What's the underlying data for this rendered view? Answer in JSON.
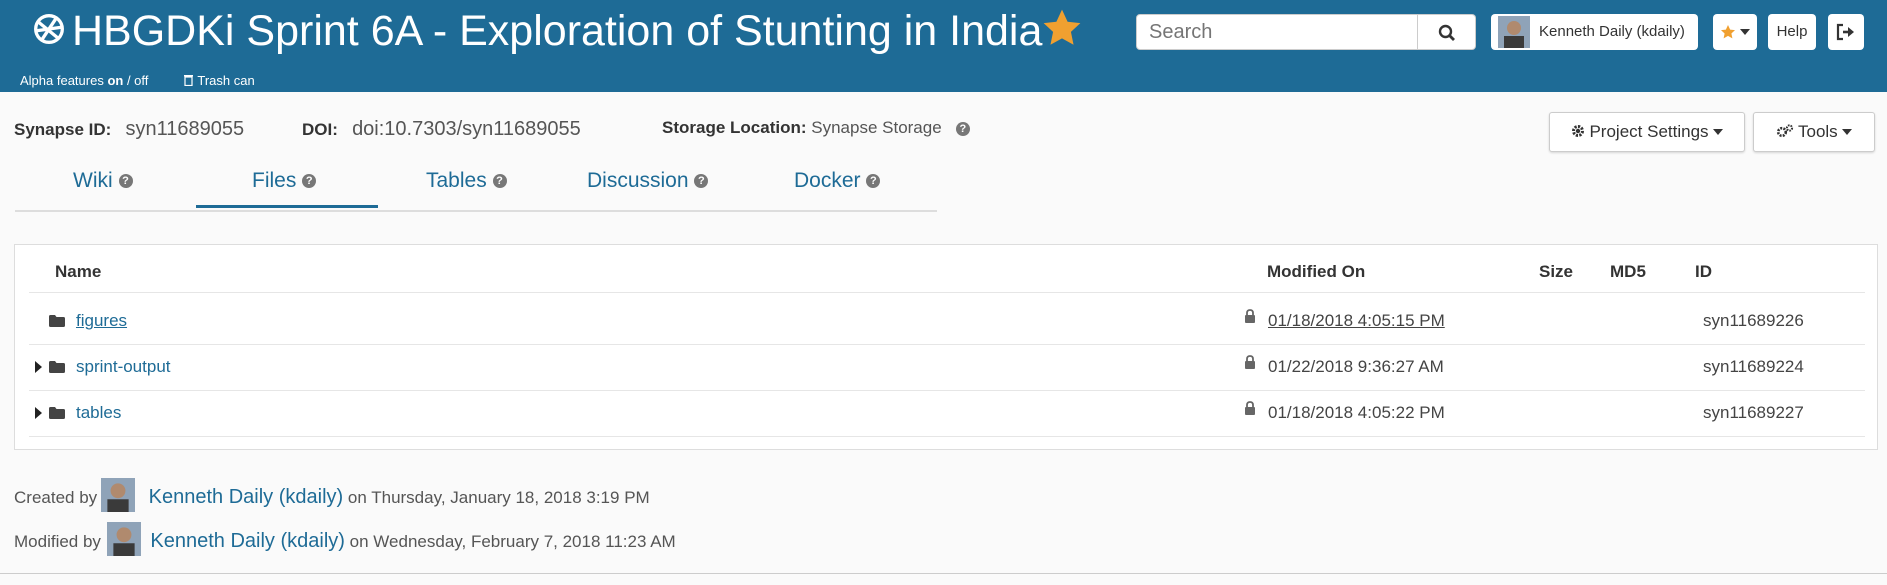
{
  "header": {
    "title": "HBGDKi Sprint 6A - Exploration of Stunting in India",
    "alpha_prefix": "Alpha features ",
    "alpha_on": "on",
    "alpha_suffix": " / off",
    "trash_label": "Trash can",
    "search_placeholder": "Search",
    "user_label": "Kenneth Daily (kdaily)",
    "help_label": "Help"
  },
  "meta": {
    "synapse_id_label": "Synapse ID:",
    "synapse_id": "syn11689055",
    "doi_label": "DOI:",
    "doi": "doi:10.7303/syn11689055",
    "storage_label": "Storage Location:",
    "storage": "Synapse Storage"
  },
  "tools": {
    "project_settings": "Project Settings",
    "tools": "Tools"
  },
  "tabs": [
    {
      "label": "Wiki"
    },
    {
      "label": "Files"
    },
    {
      "label": "Tables"
    },
    {
      "label": "Discussion"
    },
    {
      "label": "Docker"
    }
  ],
  "files": {
    "columns": {
      "name": "Name",
      "modified": "Modified On",
      "size": "Size",
      "md5": "MD5",
      "id": "ID"
    },
    "rows": [
      {
        "name": "figures",
        "modified": "01/18/2018 4:05:15 PM",
        "id": "syn11689226"
      },
      {
        "name": "sprint-output",
        "modified": "01/22/2018 9:36:27 AM",
        "id": "syn11689224"
      },
      {
        "name": "tables",
        "modified": "01/18/2018 4:05:22 PM",
        "id": "syn11689227"
      }
    ]
  },
  "footer": {
    "created_prefix": "Created by",
    "created_user": "Kenneth Daily (kdaily)",
    "created_suffix": "on Thursday, January 18, 2018 3:19 PM",
    "modified_prefix": "Modified by",
    "modified_user": "Kenneth Daily (kdaily)",
    "modified_suffix": "on Wednesday, February 7, 2018 11:23 AM"
  },
  "colors": {
    "header_bg": "#1e6b96",
    "link": "#1e6b96",
    "star": "#f0a030"
  }
}
